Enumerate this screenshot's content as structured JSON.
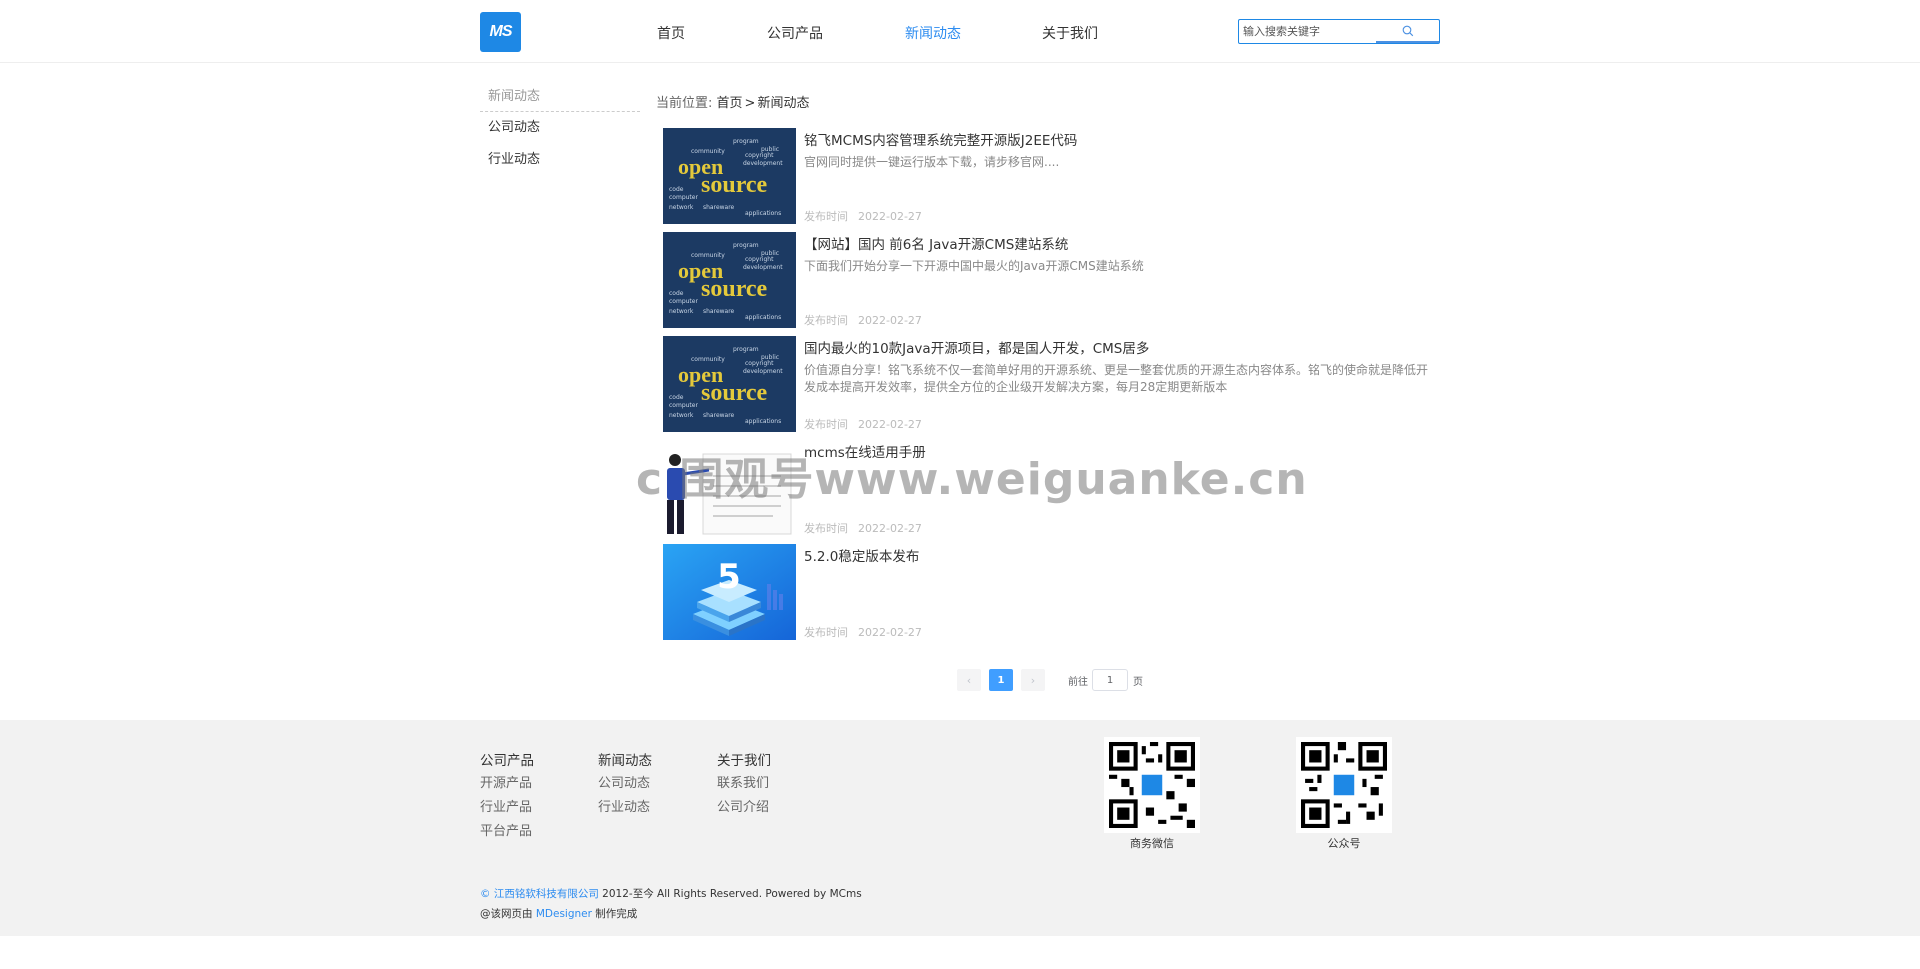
{
  "header": {
    "logo_text": "MS",
    "nav": [
      "首页",
      "公司产品",
      "新闻动态",
      "关于我们"
    ],
    "active_nav": "新闻动态",
    "search_placeholder": "输入搜索关键字"
  },
  "sidebar": {
    "title": "新闻动态",
    "items": [
      "公司动态",
      "行业动态"
    ]
  },
  "breadcrumb": {
    "prefix": "当前位置:",
    "home": "首页",
    "separator": ">",
    "current": "新闻动态"
  },
  "news": [
    {
      "title": "铭飞MCMS内容管理系统完整开源版J2EE代码",
      "desc": "官网同时提供一键运行版本下载，请步移官网....",
      "date_label": "发布时间",
      "date": "2022-02-27",
      "thumb": "open-source"
    },
    {
      "title": "【网站】国内 前6名 Java开源CMS建站系统",
      "desc": "下面我们开始分享一下开源中国中最火的Java开源CMS建站系统",
      "date_label": "发布时间",
      "date": "2022-02-27",
      "thumb": "open-source"
    },
    {
      "title": "国内最火的10款Java开源项目，都是国人开发，CMS居多",
      "desc": "价值源自分享！铭飞系统不仅一套简单好用的开源系统、更是一整套优质的开源生态内容体系。铭飞的使命就是降低开发成本提高开发效率，提供全方位的企业级开发解决方案，每月28定期更新版本",
      "date_label": "发布时间",
      "date": "2022-02-27",
      "thumb": "open-source"
    },
    {
      "title": "mcms在线适用手册",
      "desc": "",
      "date_label": "发布时间",
      "date": "2022-02-27",
      "thumb": "manual"
    },
    {
      "title": "5.2.0稳定版本发布",
      "desc": "",
      "date_label": "发布时间",
      "date": "2022-02-27",
      "thumb": "version5"
    }
  ],
  "pagination": {
    "prev": "‹",
    "current": "1",
    "next": "›",
    "goto_label": "前往",
    "goto_value": "1",
    "page_suffix": "页"
  },
  "footer": {
    "columns": [
      {
        "title": "公司产品",
        "links": [
          "开源产品",
          "行业产品",
          "平台产品"
        ]
      },
      {
        "title": "新闻动态",
        "links": [
          "公司动态",
          "行业动态"
        ]
      },
      {
        "title": "关于我们",
        "links": [
          "联系我们",
          "公司介绍"
        ]
      }
    ],
    "qrcodes": [
      {
        "label": "商务微信"
      },
      {
        "label": "公众号"
      }
    ],
    "copyright_company": "© 江西铭软科技有限公司",
    "copyright_rest": " 2012-至今 All Rights Reserved. Powered by MCms",
    "made_prefix": "@该网页由 ",
    "made_link": "MDesigner",
    "made_suffix": " 制作完成"
  },
  "watermark": "c 围观号www.weiguanke.cn",
  "colors": {
    "accent": "#2d8cf0",
    "logo": "#1e88e5",
    "footer_bg": "#f2f2f2",
    "page_active": "#409eff"
  }
}
